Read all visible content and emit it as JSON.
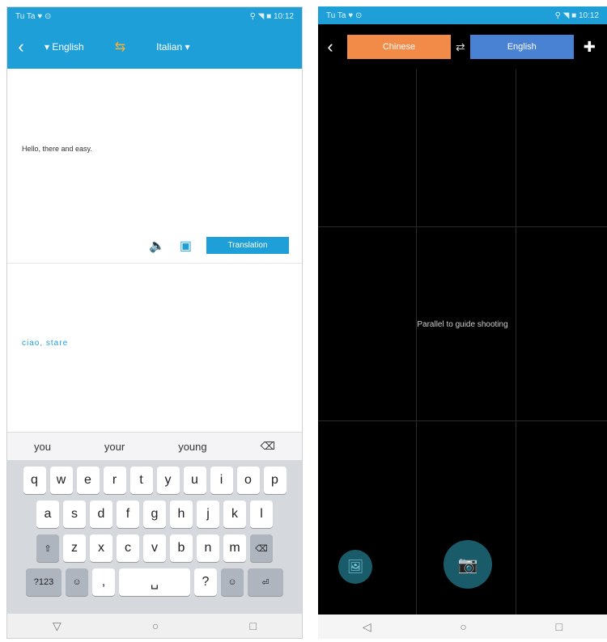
{
  "left": {
    "status": {
      "left": "Tu Ta ♥ ⊙",
      "right": "⚲ ◥ ■ 10:12"
    },
    "appbar": {
      "back": "‹",
      "source_lang": "▾ English",
      "swap": "⇆",
      "target_lang": "Italian ▾"
    },
    "input_text": "Hello, there and easy.",
    "actions": {
      "speak_icon": "🔈",
      "clear_icon": "▣",
      "translate": "Translation"
    },
    "result_text": "ciao, stare",
    "suggestions": [
      "you",
      "your",
      "young",
      "⌫"
    ],
    "keyboard": {
      "row1": [
        "q",
        "w",
        "e",
        "r",
        "t",
        "y",
        "u",
        "i",
        "o",
        "p"
      ],
      "row2": [
        "a",
        "s",
        "d",
        "f",
        "g",
        "h",
        "j",
        "k",
        "l"
      ],
      "row3": [
        "⇧",
        "z",
        "x",
        "c",
        "v",
        "b",
        "n",
        "m",
        "⌫"
      ],
      "row4": [
        "?123",
        "☺",
        ",",
        "␣",
        "?",
        "☺",
        "⏎"
      ]
    },
    "nav": [
      "▽",
      "○",
      "□"
    ]
  },
  "right": {
    "status": {
      "left": "Tu Ta ♥ ⊙",
      "right": "⚲ ◥ ■ 10:12"
    },
    "cambar": {
      "back": "‹",
      "source_lang": "Chinese",
      "swap": "⇄",
      "target_lang": "English",
      "plus": "✚"
    },
    "hint": "Parallel to guide shooting",
    "gallery_icon": "🖼",
    "shutter_icon": "📷",
    "nav": [
      "◁",
      "○",
      "□"
    ]
  }
}
